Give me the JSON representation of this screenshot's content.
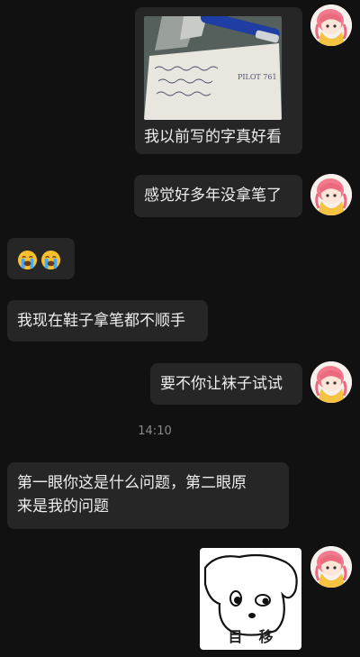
{
  "messages": [
    {
      "sender": "me",
      "kind": "image_with_caption",
      "caption": "我以前写的字真好看",
      "image_text": "PILOT 761"
    },
    {
      "sender": "me",
      "kind": "text",
      "text": "感觉好多年没拿笔了"
    },
    {
      "sender": "other",
      "kind": "emoji",
      "emoji": [
        "loudly-crying-face",
        "loudly-crying-face"
      ]
    },
    {
      "sender": "other",
      "kind": "text",
      "text": "我现在鞋子拿笔都不顺手"
    },
    {
      "sender": "me",
      "kind": "text",
      "text": "要不你让袜子试试"
    },
    {
      "sender": "other",
      "kind": "text",
      "lines": [
        "第一眼你这是什么问题，第二眼原",
        "来是我的问题"
      ]
    },
    {
      "sender": "me",
      "kind": "sticker",
      "sticker_text": "目移"
    }
  ],
  "timestamp": "14:10"
}
